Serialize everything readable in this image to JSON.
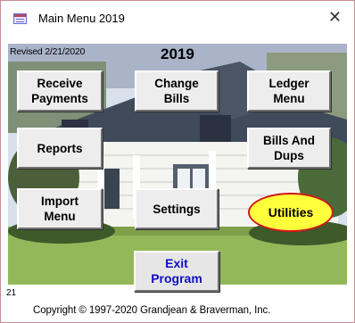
{
  "window": {
    "title": "Main Menu 2019",
    "close_glyph": "✕"
  },
  "header": {
    "revised": "Revised 2/21/2020",
    "year": "2019"
  },
  "buttons": {
    "receive_payments": "Receive\nPayments",
    "change_bills": "Change\nBills",
    "ledger_menu": "Ledger\nMenu",
    "reports": "Reports",
    "bills_and_dups": "Bills And\nDups",
    "import_menu": "Import\nMenu",
    "settings": "Settings",
    "utilities": "Utilities",
    "exit_program": "Exit\nProgram"
  },
  "footer": {
    "version": "21",
    "copyright": "Copyright © 1997-2020 Grandjean & Braverman, Inc."
  },
  "colors": {
    "utilities_fill": "#ffff3c",
    "utilities_border": "#d01818",
    "exit_text": "#1010c0"
  },
  "icons": {
    "app": "form-window-icon",
    "close": "close-icon"
  }
}
